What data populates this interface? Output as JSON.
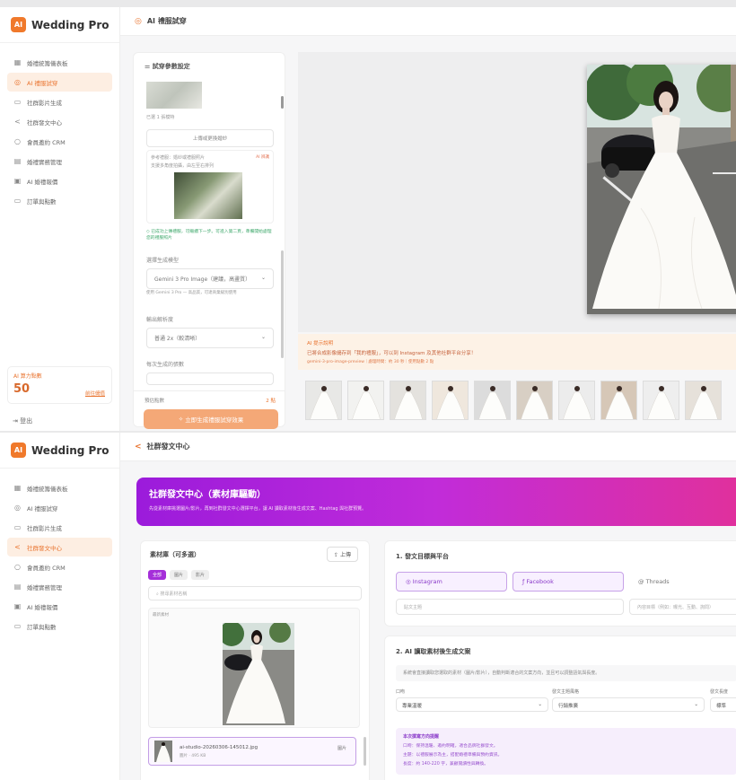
{
  "brand": {
    "name": "Wedding Pro",
    "logo": "AI"
  },
  "panel1": {
    "nav": [
      {
        "label": "婚禮統籌儀表板",
        "icon": "grid-icon"
      },
      {
        "label": "AI 禮服試穿",
        "icon": "palette-icon",
        "active": true
      },
      {
        "label": "社群影片生成",
        "icon": "video-icon"
      },
      {
        "label": "社群發文中心",
        "icon": "share-icon"
      },
      {
        "label": "會員邀約 CRM",
        "icon": "circle-icon"
      },
      {
        "label": "婚禮實務管理",
        "icon": "doc-icon"
      },
      {
        "label": "AI 婚禮報價",
        "icon": "calc-icon"
      },
      {
        "label": "訂單與點數",
        "icon": "card-icon"
      }
    ],
    "credit": {
      "label": "AI 算力點數",
      "value": "50",
      "link": "前往儲值"
    },
    "logout": "登出",
    "topbar": "AI 禮服試穿",
    "form": {
      "title": "試穿參數設定",
      "img_caption": "已選 1 張模特",
      "upload_label": "上傳或更換婚紗",
      "dress_hint_title": "參考禮服：婚紗或禮服照片",
      "dress_hint_badge": "AI 辨識",
      "dress_hint_text": "支援多角度拍攝，由左至右排列",
      "success_text": "已成功上傳禮服，可繼續下一步。可進入第二頁，準備開始處理您的禮服照片",
      "model_label": "選擇生成模型",
      "model_value": "Gemini 3 Pro Image（建議，高畫質）",
      "model_hint": "使用 Gemini 3 Pro — 高品質，可達商業級別使用",
      "res_label": "輸出解析度",
      "res_value": "普通 2x（較清晰）",
      "count_label": "每次生成的張數",
      "cost_label": "預估點數",
      "cost_value": "2 點",
      "generate_label": "立即生成禮服試穿效果"
    },
    "notice": {
      "title": "AI 提示說明",
      "line1": "已將合成影像儲存到「我的禮服」，可以到 Instagram 及其他社群平台分享！",
      "line2": "gemini-3-pro-image-preview｜處理時間：約 30 秒｜使用點數 2 點"
    }
  },
  "panel2": {
    "nav": [
      {
        "label": "婚禮統籌儀表板",
        "icon": "grid-icon"
      },
      {
        "label": "AI 禮服試穿",
        "icon": "palette-icon"
      },
      {
        "label": "社群影片生成",
        "icon": "video-icon"
      },
      {
        "label": "社群發文中心",
        "icon": "share-icon",
        "active": true
      },
      {
        "label": "會員邀約 CRM",
        "icon": "circle-icon"
      },
      {
        "label": "婚禮實務管理",
        "icon": "doc-icon"
      },
      {
        "label": "AI 婚禮報價",
        "icon": "calc-icon"
      },
      {
        "label": "訂單與點數",
        "icon": "card-icon"
      }
    ],
    "topbar": "社群發文中心",
    "banner": {
      "title": "社群發文中心（素材庫驅動）",
      "subtitle": "先從素材庫挑選圖片/影片，再到社群發文中心選擇平台，讓 AI 讀取素材後生成文案、Hashtag 與社群預覽。"
    },
    "library": {
      "title": "素材庫（可多選）",
      "upload": "上傳",
      "filters": [
        "全部",
        "圖片",
        "影片"
      ],
      "search_placeholder": "搜尋素材名稱",
      "grid_label": "最新素材",
      "file_name": "ai-studio-20260306-145012.jpg",
      "file_meta": "圖片 · 495 KB",
      "file_type": "圖片"
    },
    "platform": {
      "title": "1. 發文目標與平台",
      "items": [
        "Instagram",
        "Facebook",
        "Threads"
      ],
      "topic_placeholder": "貼文主題",
      "target_placeholder": "內容目標（例如：曝光、互動、詢問）"
    },
    "copy": {
      "title": "2. AI 讀取素材後生成文案",
      "desc": "系統會直接讀取您選取的素材（圖片/影片），自動判斷適合的文案方向，並且可以調整語氣與長度。",
      "tone_label": "口吻",
      "tone_value": "專業溫暖",
      "style_label": "發文主題風格",
      "style_value": "行銷推廣",
      "len_label": "發文長度",
      "len_value": "標準",
      "tips_title": "本次撰寫方向提醒",
      "tips": [
        "口吻：保持溫暖、邀約明確，適合品牌社群發文。",
        "主題：以禮服展示為主，搭配婚禮準備與預約資訊。",
        "長度：約 140-220 字，兼顧閱讀性與轉換。"
      ]
    }
  }
}
